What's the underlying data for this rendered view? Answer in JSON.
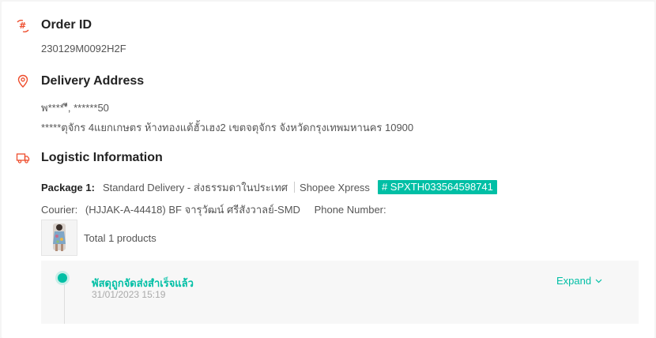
{
  "order": {
    "heading": "Order ID",
    "id": "230129M0092H2F",
    "icon": "order-id-icon"
  },
  "delivery": {
    "heading": "Delivery Address",
    "line1": "พ*****ี, ******50",
    "line2": "*****ตุจักร 4แยกเกษตร ห้างทองแต้ฮั้วเฮง2 เขตจตุจักร จังหวัดกรุงเทพมหานคร 10900",
    "icon": "location-pin-icon"
  },
  "logistic": {
    "heading": "Logistic Information",
    "icon": "truck-icon",
    "package_label": "Package 1:",
    "service": "Standard Delivery - ส่งธรรมดาในประเทศ",
    "carrier": "Shopee Xpress",
    "tracking": "# SPXTH033564598741",
    "courier_label": "Courier:",
    "courier_value": "(HJJAK-A-44418) BF จารุวัฒน์ ศรีสังวาลย์-SMD",
    "phone_label": "Phone Number:",
    "total_products": "Total 1 products"
  },
  "timeline": {
    "status": "พัสดุถูกจัดส่งสำเร็จแล้ว",
    "time": "31/01/2023 15:19",
    "expand_label": "Expand"
  },
  "colors": {
    "accent": "#00bfa5",
    "icon": "#ee4d2d"
  }
}
